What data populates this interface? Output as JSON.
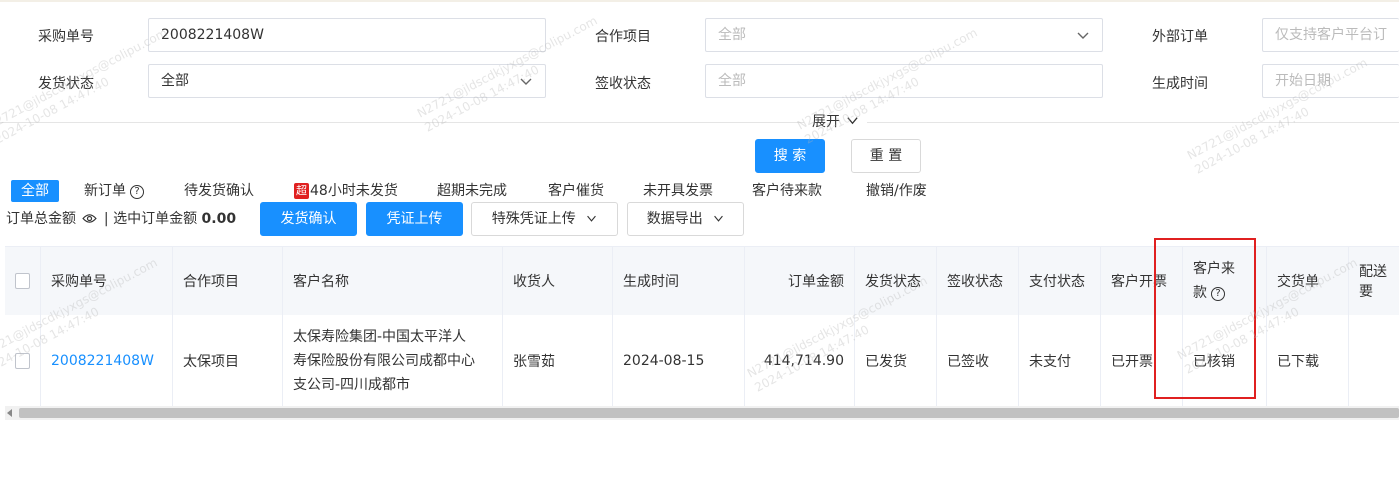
{
  "filters": {
    "order_no_label": "采购单号",
    "order_no_value": "2008221408W",
    "project_label": "合作项目",
    "project_placeholder": "全部",
    "external_label": "外部订单",
    "external_placeholder": "仅支持客户平台订",
    "ship_status_label": "发货状态",
    "ship_status_value": "全部",
    "sign_status_label": "签收状态",
    "sign_status_placeholder": "全部",
    "created_label": "生成时间",
    "created_placeholder": "开始日期",
    "expand_label": "展开"
  },
  "actions": {
    "search": "搜 索",
    "reset": "重 置"
  },
  "tabs": [
    {
      "label": "全部"
    },
    {
      "label": "新订单"
    },
    {
      "label": "待发货确认"
    },
    {
      "label": "48小时未发货",
      "badge": "超"
    },
    {
      "label": "超期未完成"
    },
    {
      "label": "客户催货"
    },
    {
      "label": "未开具发票"
    },
    {
      "label": "客户待来款"
    },
    {
      "label": "撤销/作废"
    }
  ],
  "summary": {
    "total_label": "订单总金额",
    "selected_label": "| 选中订单金额",
    "selected_value": "0.00"
  },
  "toolbar": {
    "ship_confirm": "发货确认",
    "upload_voucher": "凭证上传",
    "special_upload": "特殊凭证上传",
    "export": "数据导出"
  },
  "table": {
    "headers": [
      "采购单号",
      "合作项目",
      "客户名称",
      "收货人",
      "生成时间",
      "订单金额",
      "发货状态",
      "签收状态",
      "支付状态",
      "客户开票",
      "客户来款",
      "交货单",
      "配送要"
    ],
    "header_payment_line1": "客户来",
    "header_payment_line2": "款",
    "rows": [
      {
        "order_no": "2008221408W",
        "project": "太保项目",
        "customer_line1": "太保寿险集团-中国太平洋人",
        "customer_line2": "寿保险股份有限公司成都中心",
        "customer_line3": "支公司-四川成都市",
        "receiver": "张雪茹",
        "created": "2024-08-15",
        "amount": "414,714.90",
        "ship_status": "已发货",
        "sign_status": "已签收",
        "pay_status": "未支付",
        "invoice": "已开票",
        "payment": "已核销",
        "delivery": "已下载"
      }
    ]
  },
  "watermark": {
    "line1": "N2721@jldscdkjyxgs@colipu.com",
    "line2": "2024-10-08 14:47:40"
  },
  "colors": {
    "primary": "#1890ff",
    "highlight": "#e02020",
    "badge": "#e02020"
  }
}
